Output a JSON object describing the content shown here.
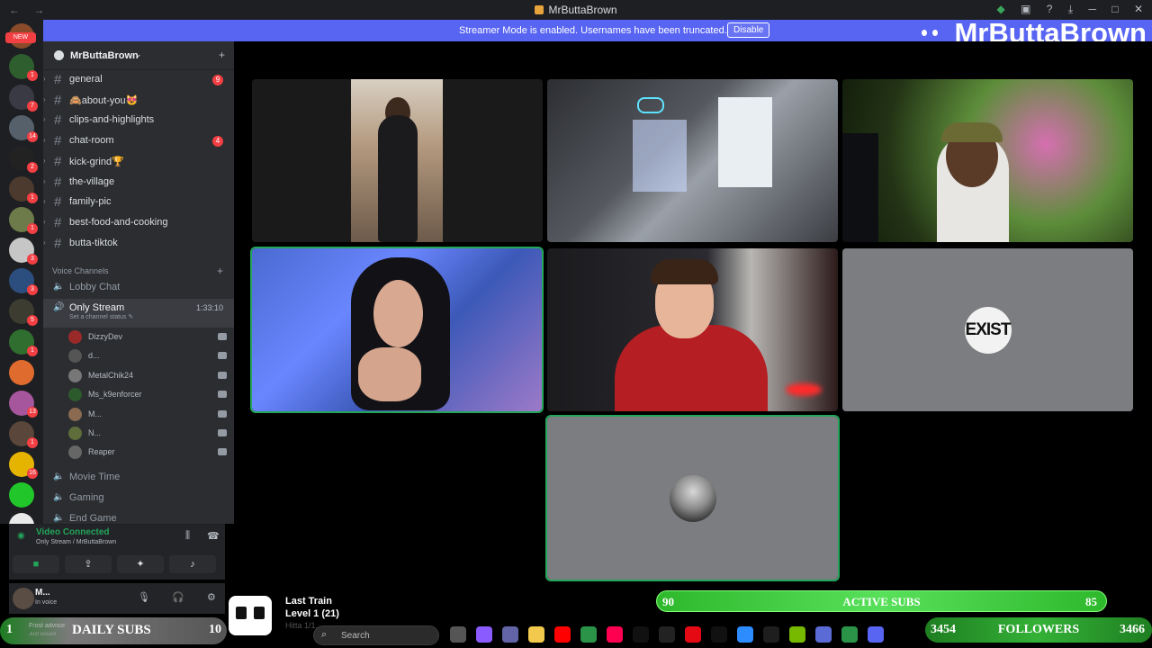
{
  "window": {
    "title": "MrButtaBrown",
    "nav_arrows": "← →",
    "controls": [
      "─",
      "□",
      "✕"
    ]
  },
  "banner": {
    "message": "Streamer Mode is enabled. Usernames have been truncated.",
    "button": "Disable"
  },
  "brand": {
    "name": "MrButtaBrown"
  },
  "servers": {
    "items": [
      {
        "badge": "NEW",
        "color": "#8a4b2b",
        "newtag": true
      },
      {
        "badge": "1",
        "color": "#2e5e2e"
      },
      {
        "badge": "7",
        "color": "#3a3a44"
      },
      {
        "badge": "14",
        "color": "#55606a"
      },
      {
        "badge": "2",
        "color": "#222"
      },
      {
        "badge": "1",
        "color": "#4b3a2d"
      },
      {
        "badge": "1",
        "color": "#6d7b4a"
      },
      {
        "badge": "3",
        "color": "#c6c6c6"
      },
      {
        "badge": "3",
        "color": "#2b4e7e"
      },
      {
        "badge": "5",
        "color": "#3c3c30"
      },
      {
        "badge": "1",
        "color": "#2f6e2f"
      },
      {
        "badge": "",
        "color": "#e06b2f"
      },
      {
        "badge": "13",
        "color": "#a5569c"
      },
      {
        "badge": "1",
        "color": "#5a463a"
      },
      {
        "badge": "16",
        "color": "#e5b400"
      },
      {
        "badge": "",
        "color": "#20c62a"
      },
      {
        "badge": "7",
        "color": "#eaeaea"
      },
      {
        "badge": "NEW",
        "color": "#7a2b2b",
        "newtag": true
      }
    ]
  },
  "guild": {
    "name": "MrButtaBrown",
    "invite_icon": "+"
  },
  "text_channels": [
    {
      "label": "general",
      "badge": "9"
    },
    {
      "label": "🙈about-you😻",
      "badge": ""
    },
    {
      "label": "clips-and-highlights",
      "badge": ""
    },
    {
      "label": "chat-room",
      "badge": "4"
    },
    {
      "label": "kick-grind🏆",
      "badge": ""
    },
    {
      "label": "the-village",
      "badge": ""
    },
    {
      "label": "family-pic",
      "badge": ""
    },
    {
      "label": "best-food-and-cooking",
      "badge": ""
    },
    {
      "label": "butta-tiktok",
      "badge": ""
    }
  ],
  "voice_section": {
    "header": "Voice Channels",
    "add": "+"
  },
  "voice_channels": {
    "lobby": "Lobby Chat",
    "only_stream": "Only Stream",
    "only_stream_timer": "1:33:10",
    "only_stream_status": "Set a channel status ✎",
    "movie": "Movie Time",
    "gaming": "Gaming",
    "end_game": "End Game"
  },
  "members": [
    {
      "name": "DizzyDev",
      "color": "#9a2a2a"
    },
    {
      "name": "d...",
      "color": "#555"
    },
    {
      "name": "MetalChik24",
      "color": "#777"
    },
    {
      "name": "Ms_k9enforcer",
      "color": "#2d5a2d"
    },
    {
      "name": "M...",
      "color": "#8a6a50"
    },
    {
      "name": "N...",
      "color": "#5d6e3a"
    },
    {
      "name": "Reaper",
      "color": "#666"
    }
  ],
  "voice_panel": {
    "title": "Video Connected",
    "subtitle": "Only Stream / MrButtaBrown"
  },
  "user_panel": {
    "name": "M...",
    "status": "In voice"
  },
  "stream_tiles": [
    {
      "name": "tile-1"
    },
    {
      "name": "tile-2"
    },
    {
      "name": "tile-3"
    },
    {
      "name": "tile-4"
    },
    {
      "name": "tile-5"
    },
    {
      "name": "tile-6",
      "avatar_text": "EXIST"
    },
    {
      "name": "tile-7"
    }
  ],
  "overlays": {
    "subs": {
      "left": "90",
      "label": "ACTIVE SUBS",
      "right": "85",
      "progress_pct": 100
    },
    "followers": {
      "left": "3454",
      "label": "FOLLOWERS",
      "right": "3466"
    },
    "daily": {
      "left": "1",
      "label": "DAILY SUBS",
      "right": "10",
      "notice": "Frost advisor",
      "notice2": "Just issued"
    },
    "music": {
      "song": "Last Train",
      "level": "Level 1 (21)",
      "faint": "Hitta 1/1..."
    }
  },
  "taskbar": {
    "search_placeholder": "Search",
    "apps": [
      "#555",
      "#8a5cff",
      "#6264a7",
      "#f2c94c",
      "#ff0000",
      "#2b9348",
      "#ff0050",
      "#111",
      "#222",
      "#e50914",
      "#111",
      "#2d8cff",
      "#1e1e1e",
      "#76b900",
      "#5b6bd6",
      "#2b9348",
      "#5865f2"
    ]
  },
  "colors": {
    "accent": "#5865f2",
    "green": "#23a55a",
    "badge_red": "#f23f43"
  }
}
